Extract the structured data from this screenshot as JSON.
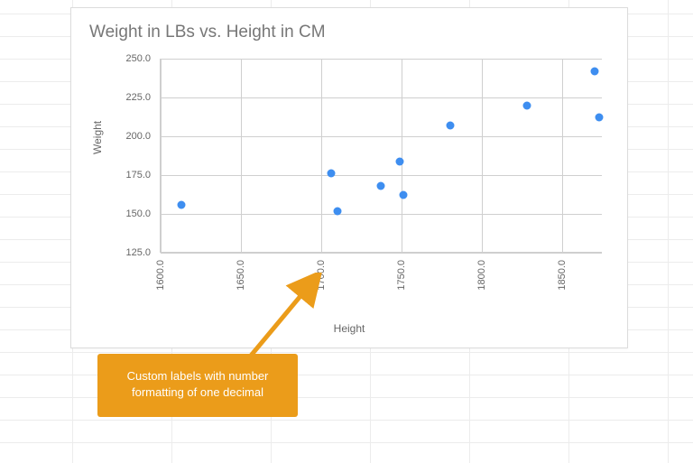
{
  "chart_data": {
    "type": "scatter",
    "title": "Weight in LBs vs. Height in CM",
    "xlabel": "Height",
    "ylabel": "Weight",
    "xlim": [
      1600,
      1875
    ],
    "ylim": [
      125,
      250
    ],
    "xticks": [
      "1600.0",
      "1650.0",
      "1700.0",
      "1750.0",
      "1800.0",
      "1850.0"
    ],
    "yticks": [
      "125.0",
      "150.0",
      "175.0",
      "200.0",
      "225.0",
      "250.0"
    ],
    "series": [
      {
        "name": "Weight",
        "points": [
          {
            "x": 1613,
            "y": 156
          },
          {
            "x": 1706,
            "y": 176
          },
          {
            "x": 1710,
            "y": 152
          },
          {
            "x": 1737,
            "y": 168
          },
          {
            "x": 1749,
            "y": 184
          },
          {
            "x": 1751,
            "y": 162
          },
          {
            "x": 1780,
            "y": 207
          },
          {
            "x": 1828,
            "y": 220
          },
          {
            "x": 1870,
            "y": 242
          },
          {
            "x": 1873,
            "y": 212
          }
        ]
      }
    ]
  },
  "callout": {
    "text": "Custom labels with number formatting of one decimal"
  }
}
